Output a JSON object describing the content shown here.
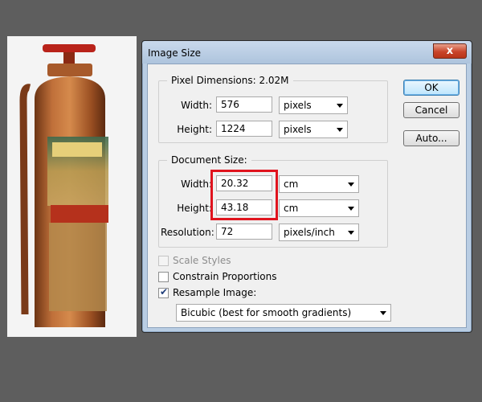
{
  "dialog": {
    "title": "Image Size",
    "close_label": "x"
  },
  "pixel_dimensions": {
    "title": "Pixel Dimensions:  2.02M",
    "width_label": "Width:",
    "width_value": "576",
    "width_unit": "pixels",
    "height_label": "Height:",
    "height_value": "1224",
    "height_unit": "pixels"
  },
  "document_size": {
    "title": "Document Size:",
    "width_label": "Width:",
    "width_value": "20.32",
    "width_unit": "cm",
    "height_label": "Height:",
    "height_value": "43.18",
    "height_unit": "cm",
    "resolution_label": "Resolution:",
    "resolution_value": "72",
    "resolution_unit": "pixels/inch"
  },
  "buttons": {
    "ok": "OK",
    "cancel": "Cancel",
    "auto": "Auto..."
  },
  "options": {
    "scale_styles": "Scale Styles",
    "scale_styles_checked": false,
    "constrain_proportions": "Constrain Proportions",
    "constrain_checked": false,
    "resample_image": "Resample Image:",
    "resample_checked": true,
    "resample_method": "Bicubic (best for smooth gradients)"
  },
  "colors": {
    "highlight": "#e0141e",
    "desktop": "#5e5e5e"
  }
}
